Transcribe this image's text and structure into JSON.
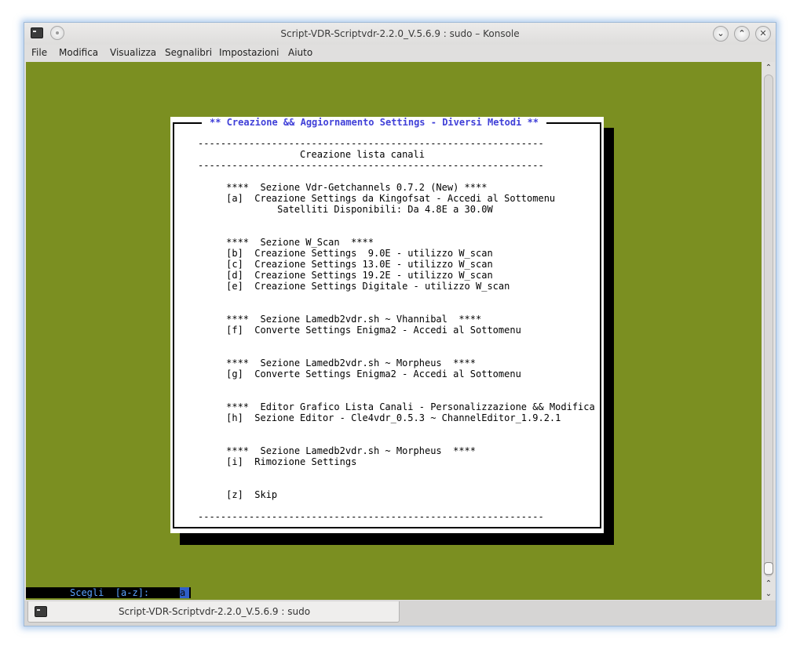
{
  "window": {
    "title": "Script-VDR-Scriptvdr-2.2.0_V.5.6.9 : sudo – Konsole",
    "buttons": {
      "minimize": "⌄",
      "maximize": "⌃",
      "close": "✕"
    }
  },
  "menubar": [
    "File",
    "Modifica",
    "Visualizza",
    "Segnalibri",
    "Impostazioni",
    "Aiuto"
  ],
  "dialog": {
    "title": "** Creazione && Aggiornamento Settings - Diversi Metodi **",
    "lines": [
      "-------------------------------------------------------------",
      "                  Creazione lista canali",
      "-------------------------------------------------------------",
      "",
      "     ****  Sezione Vdr-Getchannels 0.7.2 (New) ****",
      "     [a]  Creazione Settings da Kingofsat - Accedi al Sottomenu",
      "              Satelliti Disponibili: Da 4.8E a 30.0W",
      "",
      "",
      "     ****  Sezione W_Scan  ****",
      "     [b]  Creazione Settings  9.0E - utilizzo W_scan",
      "     [c]  Creazione Settings 13.0E - utilizzo W_scan",
      "     [d]  Creazione Settings 19.2E - utilizzo W_scan",
      "     [e]  Creazione Settings Digitale - utilizzo W_scan",
      "",
      "",
      "     ****  Sezione Lamedb2vdr.sh ~ Vhannibal  ****",
      "     [f]  Converte Settings Enigma2 - Accedi al Sottomenu",
      "",
      "",
      "     ****  Sezione Lamedb2vdr.sh ~ Morpheus  ****",
      "     [g]  Converte Settings Enigma2 - Accedi al Sottomenu",
      "",
      "",
      "     ****  Editor Grafico Lista Canali - Personalizzazione && Modifica",
      "     [h]  Sezione Editor - Cle4vdr_0.5.3 ~ ChannelEditor_1.9.2.1",
      "",
      "",
      "     ****  Sezione Lamedb2vdr.sh ~ Morpheus  ****",
      "     [i]  Rimozione Settings",
      "",
      "",
      "     [z]  Skip",
      "",
      "",
      "-------------------------------------------------------------"
    ]
  },
  "prompt": {
    "label": "Scegli  [a-z]:",
    "value": "a"
  },
  "tab": {
    "label": "Script-VDR-Scriptvdr-2.2.0_V.5.6.9 : sudo"
  },
  "colors": {
    "terminal_bg": "#7b8f21",
    "dialog_title": "#4040d8",
    "prompt_label": "#5aa2ff",
    "cursor": "#2f5fc8"
  }
}
